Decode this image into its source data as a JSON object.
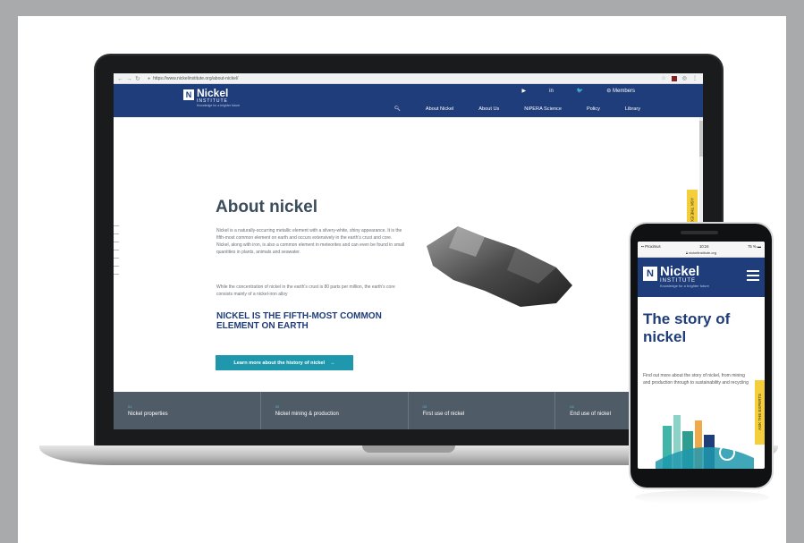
{
  "browser": {
    "url": "https://www.nickelinstitute.org/about-nickel/"
  },
  "site": {
    "logo_name": "Nickel",
    "logo_sub": "INSTITUTE",
    "logo_tagline": "Knowledge for a brighter future",
    "social": [
      "▶",
      "in",
      "🐦"
    ],
    "members_label": "Members",
    "menu": [
      "About Nickel",
      "About Us",
      "NiPERA Science",
      "Policy",
      "Library"
    ]
  },
  "hero": {
    "title": "About nickel",
    "body": "Nickel is a naturally-occurring metallic element with a silvery-white, shiny appearance. It is the fifth-most common element on earth and occurs extensively in the earth's crust and core. Nickel, along with iron, is also a common element in meteorites and can even be found in small quantities in plants, animals and seawater.",
    "body2": "While the concentration of nickel in the earth's crust is 80 parts per million, the earth's core consists mainly of a nickel-iron alloy",
    "highlight": "NICKEL IS THE FIFTH-MOST COMMON ELEMENT ON EARTH",
    "cta_label": "Learn more about the history of nickel",
    "feedback_tab": "ASK THE EXPERTS"
  },
  "strip": [
    {
      "num": "01",
      "label": "Nickel properties"
    },
    {
      "num": "02",
      "label": "Nickel mining & production"
    },
    {
      "num": "03",
      "label": "First use of nickel"
    },
    {
      "num": "04",
      "label": "End use of nickel"
    }
  ],
  "phone": {
    "carrier": "Proximus",
    "time": "10:24",
    "battery": "75 %",
    "url": "nickelinstitute.org",
    "title": "The story of nickel",
    "body": "Find out more about the story of nickel, from mining and production through to sustainability and recycling",
    "tab": "ASK THE EXPERTS"
  },
  "colors": {
    "brand_navy": "#1f3d7a",
    "accent_teal": "#1f98ad",
    "strip_grey": "#4f5b67",
    "tab_yellow": "#f5ce3c"
  }
}
